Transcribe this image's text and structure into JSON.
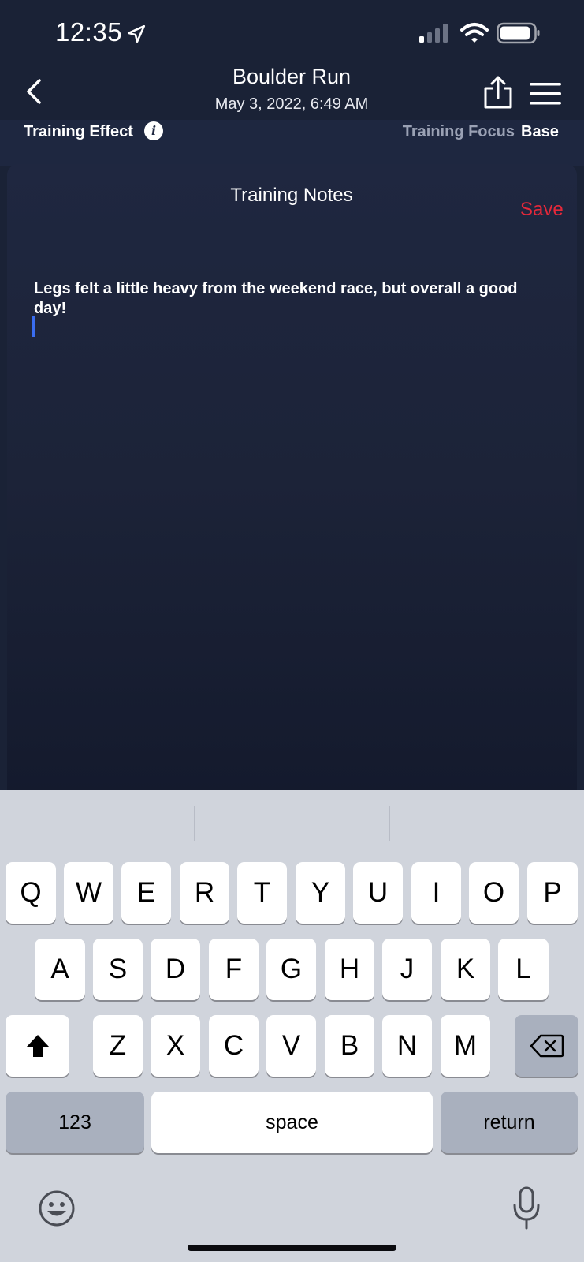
{
  "status_bar": {
    "time": "12:35"
  },
  "header": {
    "title": "Boulder Run",
    "subtitle": "May 3, 2022, 6:49 AM"
  },
  "effect_row": {
    "effect_label": "Training Effect",
    "info_glyph": "i",
    "focus_label": "Training Focus",
    "focus_value": "Base"
  },
  "notes_sheet": {
    "title": "Training Notes",
    "save_label": "Save",
    "text": "Legs felt a little heavy from the weekend race, but overall a good day!"
  },
  "keyboard": {
    "row1": [
      "Q",
      "W",
      "E",
      "R",
      "T",
      "Y",
      "U",
      "I",
      "O",
      "P"
    ],
    "row2": [
      "A",
      "S",
      "D",
      "F",
      "G",
      "H",
      "J",
      "K",
      "L"
    ],
    "row3": [
      "Z",
      "X",
      "C",
      "V",
      "B",
      "N",
      "M"
    ],
    "numbers_label": "123",
    "space_label": "space",
    "return_label": "return"
  },
  "colors": {
    "background": "#1a2236",
    "save_accent": "#e5283a",
    "caret": "#3a6df0",
    "keyboard_bg": "#d0d4dc"
  },
  "icons": [
    "location-arrow-icon",
    "signal-icon",
    "wifi-icon",
    "battery-icon",
    "back-chevron-icon",
    "share-icon",
    "menu-icon",
    "info-icon",
    "shift-icon",
    "backspace-icon",
    "emoji-icon",
    "microphone-icon"
  ]
}
